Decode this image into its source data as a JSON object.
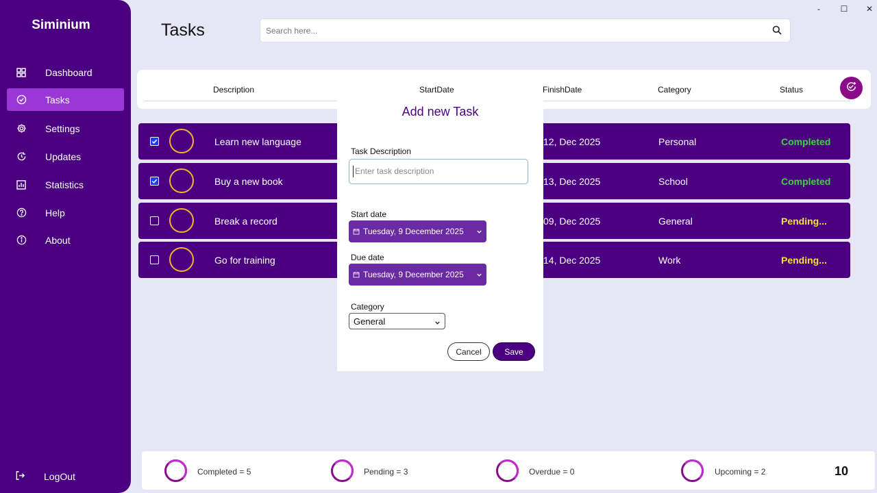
{
  "app": {
    "brand": "Siminium"
  },
  "window_controls": {
    "minimize": "-",
    "maximize": "☐",
    "close": "✕"
  },
  "sidebar": {
    "items": [
      {
        "label": "Dashboard",
        "icon": "dashboard-icon",
        "active": false
      },
      {
        "label": "Tasks",
        "icon": "tasks-check-icon",
        "active": true
      },
      {
        "label": "Settings",
        "icon": "gear-icon",
        "active": false
      },
      {
        "label": "Updates",
        "icon": "refresh-icon",
        "active": false
      },
      {
        "label": "Statistics",
        "icon": "chart-icon",
        "active": false
      },
      {
        "label": "Help",
        "icon": "help-icon",
        "active": false
      },
      {
        "label": "About",
        "icon": "info-icon",
        "active": false
      }
    ],
    "logout_label": "LogOut"
  },
  "header": {
    "title": "Tasks",
    "search_placeholder": "Search here..."
  },
  "table": {
    "columns": {
      "description": "Description",
      "start_date": "StartDate",
      "finish_date": "FinishDate",
      "category": "Category",
      "status": "Status"
    },
    "rows": [
      {
        "checked": true,
        "description": "Learn new language",
        "finish": "12, Dec 2025",
        "category": "Personal",
        "status": "Completed"
      },
      {
        "checked": true,
        "description": "Buy a new book",
        "finish": "13, Dec 2025",
        "category": "School",
        "status": "Completed"
      },
      {
        "checked": false,
        "description": "Break a record",
        "finish": "09, Dec 2025",
        "category": "General",
        "status": "Pending..."
      },
      {
        "checked": false,
        "description": "Go for training",
        "finish": "14, Dec 2025",
        "category": "Work",
        "status": "Pending..."
      }
    ]
  },
  "modal": {
    "title": "Add new Task",
    "description_label": "Task Description",
    "description_placeholder": "Enter task description",
    "description_value": "",
    "start_label": "Start date",
    "start_value": "Tuesday, 9 December 2025",
    "due_label": "Due date",
    "due_value": "Tuesday, 9 December 2025",
    "category_label": "Category",
    "category_value": "General",
    "cancel_label": "Cancel",
    "save_label": "Save"
  },
  "summary": {
    "completed": "Completed = 5",
    "pending": "Pending = 3",
    "overdue": "Overdue = 0",
    "upcoming": "Upcoming = 2",
    "total": "10"
  },
  "colors": {
    "sidebar_bg": "#4b0082",
    "active_nav": "#9a37d6",
    "accent": "#8a0a8a",
    "completed": "#3ad63a",
    "pending": "#f5e03a",
    "ring": "#f5b22e"
  }
}
